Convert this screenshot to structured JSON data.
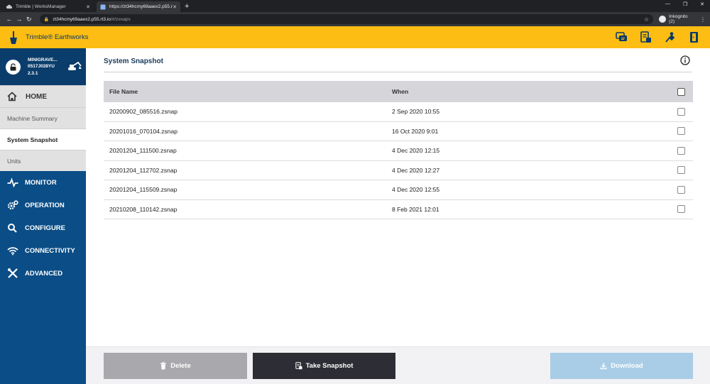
{
  "browser": {
    "tabs": [
      {
        "label": "Trimble | WorksManager",
        "close": "✕"
      },
      {
        "label": "https://zt34hcmy69aaex2.p55.rt3",
        "close": "✕"
      }
    ],
    "new_tab": "+",
    "address": {
      "host": "zt34hcmy69aaex2.p55.rt3.io",
      "path": "/#/zsnaps"
    },
    "profile": "Inkognito (2)"
  },
  "app": {
    "brand": "Trimble® Earthworks"
  },
  "sidebar": {
    "machine": {
      "name": "MINIGRAVE...",
      "serial": "0517J028YU",
      "version": "2.3.1"
    },
    "home": "HOME",
    "subitems": [
      {
        "label": "Machine Summary"
      },
      {
        "label": "System Snapshot"
      },
      {
        "label": "Units"
      }
    ],
    "main": [
      {
        "label": "MONITOR"
      },
      {
        "label": "OPERATION"
      },
      {
        "label": "CONFIGURE"
      },
      {
        "label": "CONNECTIVITY"
      },
      {
        "label": "ADVANCED"
      }
    ]
  },
  "main": {
    "title": "System Snapshot",
    "table": {
      "headers": {
        "name": "File Name",
        "when": "When"
      },
      "rows": [
        {
          "name": "20200902_085516.zsnap",
          "when": "2 Sep 2020 10:55"
        },
        {
          "name": "20201016_070104.zsnap",
          "when": "16 Oct 2020 9:01"
        },
        {
          "name": "20201204_111500.zsnap",
          "when": "4 Dec 2020 12:15"
        },
        {
          "name": "20201204_112702.zsnap",
          "when": "4 Dec 2020 12:27"
        },
        {
          "name": "20201204_115509.zsnap",
          "when": "4 Dec 2020 12:55"
        },
        {
          "name": "20210208_110142.zsnap",
          "when": "8 Feb 2021 12:01"
        }
      ]
    }
  },
  "footer": {
    "delete": "Delete",
    "take_snapshot": "Take Snapshot",
    "download": "Download"
  },
  "colors": {
    "header": "#fdbd12",
    "sidebar": "#0b4d86",
    "snapshot_button": "#2d2d35",
    "download_button": "#a9cde6",
    "delete_button": "#a9a9ad"
  }
}
